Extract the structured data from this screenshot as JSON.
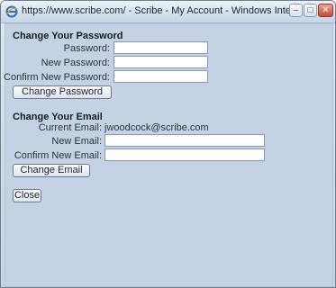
{
  "window": {
    "title": "https://www.scribe.com/ - Scribe - My Account - Windows Inter..."
  },
  "change_password": {
    "heading": "Change Your Password",
    "password_label": "Password:",
    "password_value": "",
    "new_password_label": "New Password:",
    "new_password_value": "",
    "confirm_label": "Confirm New Password:",
    "confirm_value": "",
    "button_label": "Change Password"
  },
  "change_email": {
    "heading": "Change Your Email",
    "current_label": "Current Email:",
    "current_value": "jwoodcock@scribe.com",
    "new_email_label": "New Email:",
    "new_email_value": "",
    "confirm_label": "Confirm New Email:",
    "confirm_value": "",
    "button_label": "Change Email"
  },
  "close_label": "Close"
}
